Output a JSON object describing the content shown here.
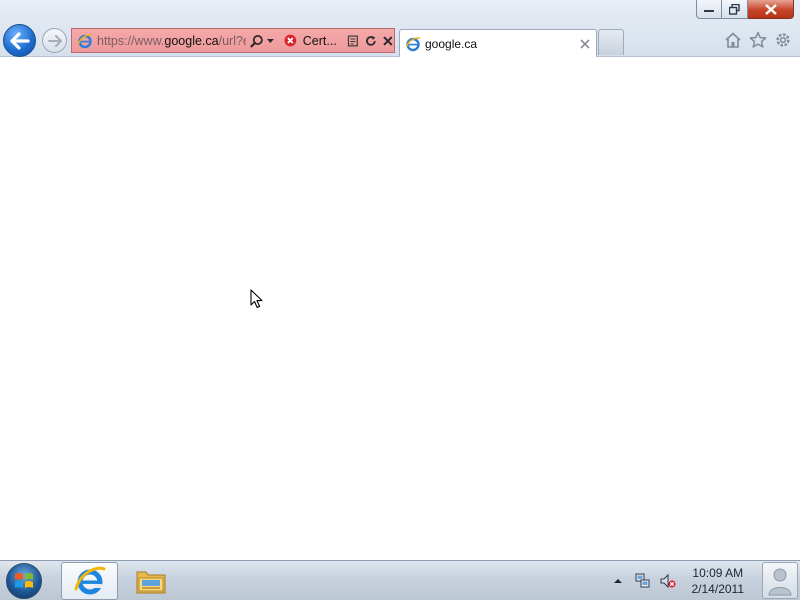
{
  "browser": {
    "address": {
      "url_prefix": "https://www.",
      "url_domain": "google.ca",
      "url_suffix": "/url?es",
      "certificate_label": "Cert...",
      "error_color": "#ee9a9d"
    },
    "tab": {
      "title": "google.ca"
    },
    "icons": [
      "back-icon",
      "forward-icon",
      "ie-favicon",
      "search-icon",
      "dropdown-icon",
      "certificate-error-icon",
      "compat-view-icon",
      "refresh-icon",
      "stop-icon",
      "close-tab-icon",
      "home-icon",
      "favorites-icon",
      "tools-icon"
    ]
  },
  "window_controls": [
    "minimize",
    "restore",
    "close"
  ],
  "taskbar": {
    "pinned": [
      "Internet Explorer",
      "Windows Explorer"
    ],
    "clock": {
      "time": "10:09 AM",
      "date": "2/14/2011"
    },
    "tray_icons": [
      "show-hidden-icons",
      "network-icon",
      "volume-muted-icon"
    ]
  }
}
